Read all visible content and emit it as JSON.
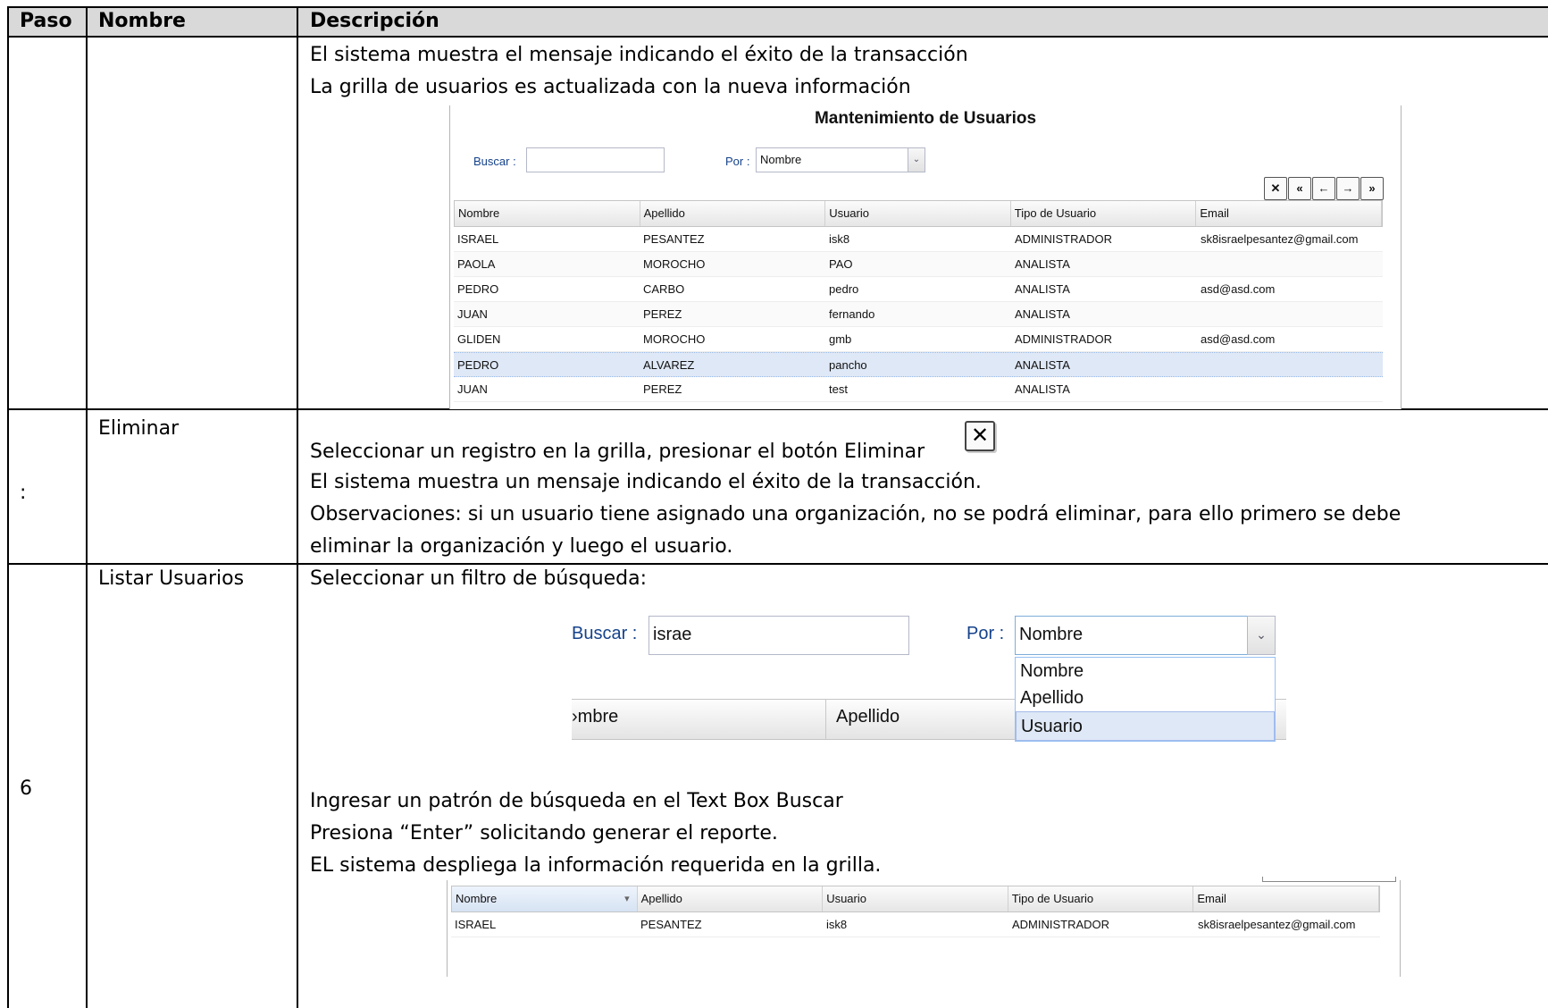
{
  "table": {
    "headers": [
      "Paso",
      "Nombre",
      "Descripción"
    ],
    "row1": {
      "lines": [
        "El sistema muestra el mensaje indicando el éxito de la transacción",
        "La grilla de usuarios es actualizada con la nueva información"
      ]
    },
    "row2": {
      "paso": ":",
      "nombre": "Eliminar",
      "lines": [
        "Seleccionar un registro en la grilla,  presionar el botón Eliminar",
        "El sistema muestra un mensaje indicando el éxito de la transacción.",
        "Observaciones: si un usuario tiene asignado una organización, no se podrá eliminar, para ello primero se debe",
        "eliminar la organización y luego el usuario."
      ],
      "delete_icon": "close-x-icon"
    },
    "row3": {
      "paso": "6",
      "nombre": "Listar Usuarios",
      "line_intro": "Seleccionar un filtro de búsqueda:",
      "lines": [
        "Ingresar un patrón de búsqueda en el Text Box Buscar",
        "Presiona “Enter” solicitando generar  el reporte.",
        "EL sistema despliega la información requerida en la grilla."
      ]
    }
  },
  "shot1": {
    "title": "Mantenimiento de Usuarios",
    "buscar_label": "Buscar :",
    "buscar_value": "",
    "por_label": "Por :",
    "por_value": "Nombre",
    "pager_icons": [
      "close-icon",
      "first-page-icon",
      "prev-page-icon",
      "next-page-icon",
      "last-page-icon"
    ],
    "columns": [
      "Nombre",
      "Apellido",
      "Usuario",
      "Tipo de Usuario",
      "Email"
    ],
    "rows": [
      [
        "ISRAEL",
        "PESANTEZ",
        "isk8",
        "ADMINISTRADOR",
        "sk8israelpesantez@gmail.com"
      ],
      [
        "PAOLA",
        "MOROCHO",
        "PAO",
        "ANALISTA",
        ""
      ],
      [
        "PEDRO",
        "CARBO",
        "pedro",
        "ANALISTA",
        "asd@asd.com"
      ],
      [
        "JUAN",
        "PEREZ",
        "fernando",
        "ANALISTA",
        ""
      ],
      [
        "GLIDEN",
        "MOROCHO",
        "gmb",
        "ADMINISTRADOR",
        "asd@asd.com"
      ],
      [
        "PEDRO",
        "ALVAREZ",
        "pancho",
        "ANALISTA",
        ""
      ],
      [
        "JUAN",
        "PEREZ",
        "test",
        "ANALISTA",
        ""
      ]
    ],
    "selected_row": 5
  },
  "shot2": {
    "buscar_label": "Buscar :",
    "buscar_value": "israe",
    "por_label": "Por :",
    "por_value": "Nombre",
    "options": [
      "Nombre",
      "Apellido",
      "Usuario"
    ],
    "highlighted_option": 2,
    "col_nombre_partial": "›mbre",
    "col_apellido": "Apellido"
  },
  "shot3": {
    "columns": [
      "Nombre",
      "Apellido",
      "Usuario",
      "Tipo de Usuario",
      "Email"
    ],
    "sort_indicator": "▾",
    "rows": [
      [
        "ISRAEL",
        "PESANTEZ",
        "isk8",
        "ADMINISTRADOR",
        "sk8israelpesantez@gmail.com"
      ]
    ]
  }
}
